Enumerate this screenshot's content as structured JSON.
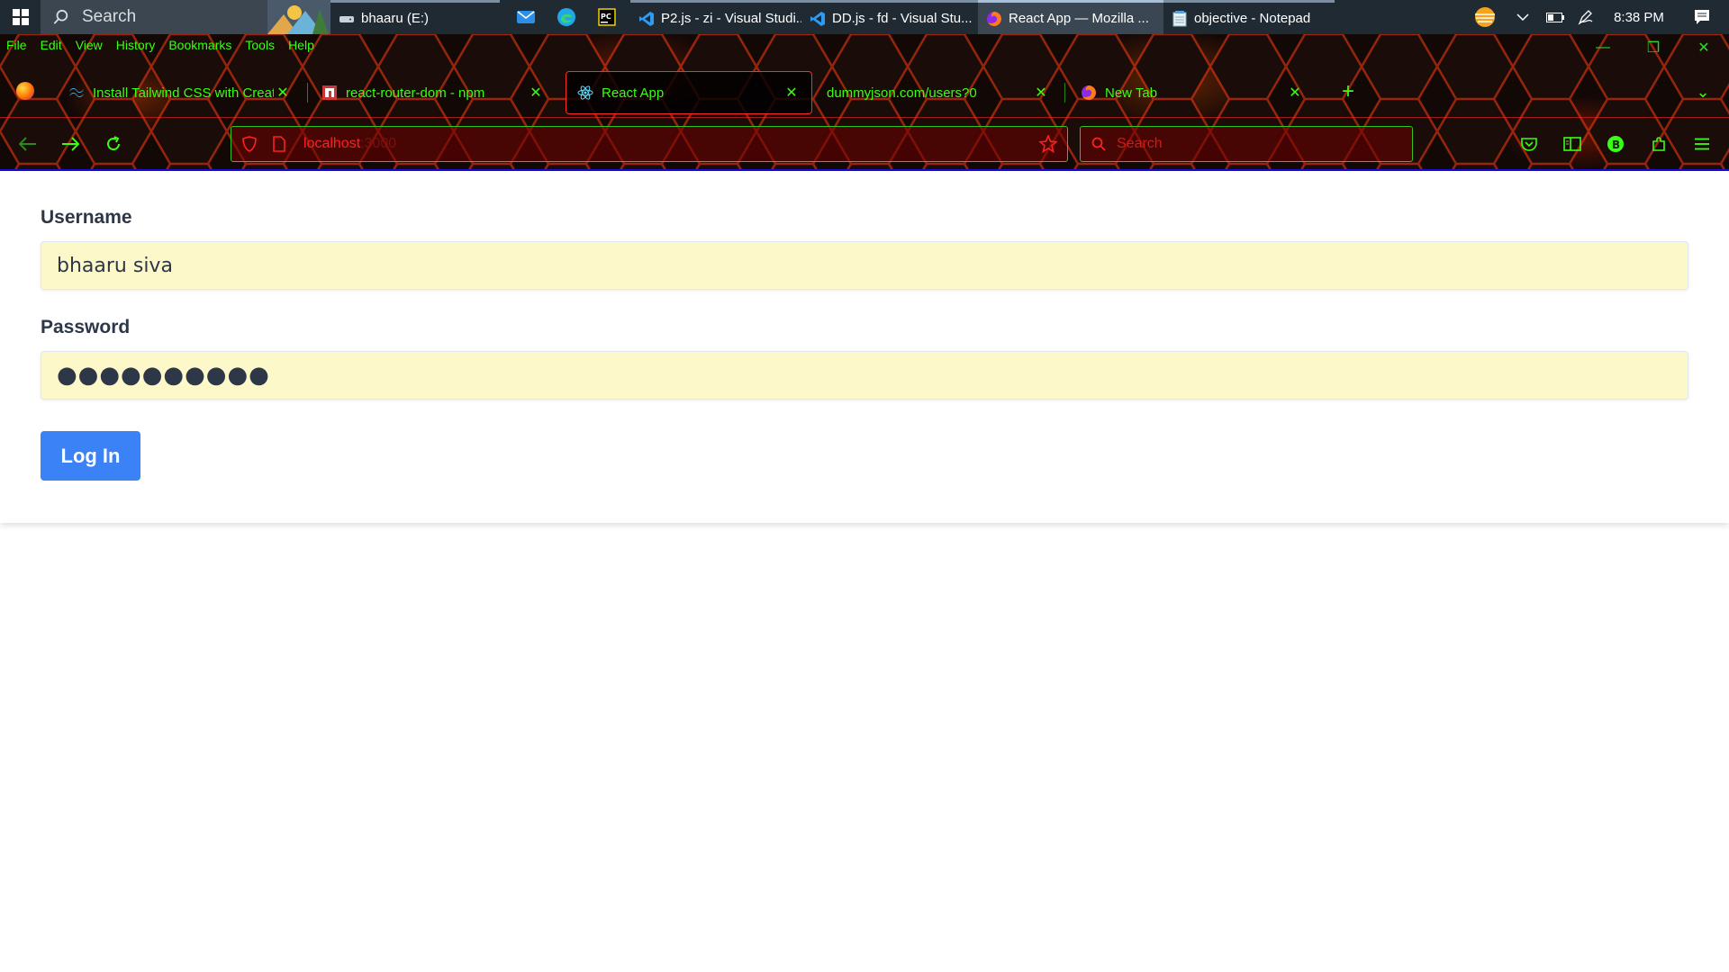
{
  "taskbar": {
    "search_placeholder": "Search",
    "apps": [
      {
        "label": "bhaaru (E:)",
        "icon": "drive-icon"
      },
      {
        "label": "P2.js - zi - Visual Studi...",
        "icon": "vscode-icon"
      },
      {
        "label": "DD.js - fd - Visual Stu...",
        "icon": "vscode-icon"
      },
      {
        "label": "React App — Mozilla ...",
        "icon": "firefox-icon"
      },
      {
        "label": "objective - Notepad",
        "icon": "notepad-icon"
      }
    ],
    "pinned": [
      "mail-icon",
      "edge-icon",
      "pycharm-icon"
    ],
    "clock": "8:38 PM"
  },
  "menubar": {
    "items": [
      "File",
      "Edit",
      "View",
      "History",
      "Bookmarks",
      "Tools",
      "Help"
    ]
  },
  "tabs": [
    {
      "label": "Install Tailwind CSS with Create",
      "icon": "tailwind-icon",
      "selected": false
    },
    {
      "label": "react-router-dom - npm",
      "icon": "npm-icon",
      "selected": false
    },
    {
      "label": "React App",
      "icon": "react-icon",
      "selected": true
    },
    {
      "label": "dummyjson.com/users?0",
      "icon": "none",
      "selected": false
    },
    {
      "label": "New Tab",
      "icon": "firefox-icon",
      "selected": false
    }
  ],
  "navbar": {
    "url_host": "localhost",
    "url_port": ":3000",
    "search_placeholder": "Search"
  },
  "form": {
    "username_label": "Username",
    "username_value": "bhaaru siva",
    "password_label": "Password",
    "password_value": "●●●●●●●●●●",
    "login_label": "Log In"
  },
  "colors": {
    "theme_accent": "#39ff14",
    "url_red": "#ff2020",
    "button_blue": "#3b82f6",
    "input_fill": "#fdf8c9",
    "label_color": "#2d3748"
  }
}
